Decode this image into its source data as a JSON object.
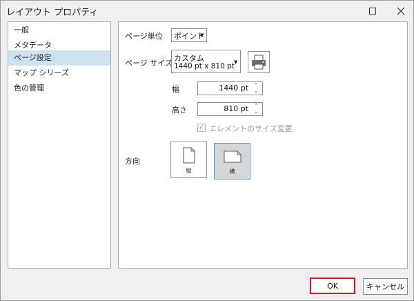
{
  "window": {
    "title": "レイアウト プロパティ",
    "maximize_icon": "maximize-icon",
    "close_icon": "close-icon"
  },
  "sidebar": {
    "items": [
      {
        "label": "一般",
        "active": false
      },
      {
        "label": "メタデータ",
        "active": false
      },
      {
        "label": "ページ設定",
        "active": true
      },
      {
        "label": "マップ シリーズ",
        "active": false
      },
      {
        "label": "色の管理",
        "active": false
      }
    ]
  },
  "page_setup": {
    "unit_label": "ページ単位",
    "unit_value": "ポイント",
    "size_label": "ページ サイズ",
    "size_name": "カスタム",
    "size_dims": "1440 pt x 810 pt",
    "print_icon": "printer-icon",
    "width_label": "幅",
    "width_value": "1440 pt",
    "height_label": "高さ",
    "height_value": "810 pt",
    "scale_elements_label": "エレメントのサイズ変更",
    "scale_elements_checked": true,
    "orientation_label": "方向",
    "portrait_label": "縦",
    "landscape_label": "横",
    "selected_orientation": "landscape"
  },
  "footer": {
    "ok_label": "OK",
    "cancel_label": "キャンセル"
  },
  "colors": {
    "selection": "#cce2f2",
    "highlight_border": "#e0161b",
    "orientation_selected_border": "#5b9bd5"
  }
}
